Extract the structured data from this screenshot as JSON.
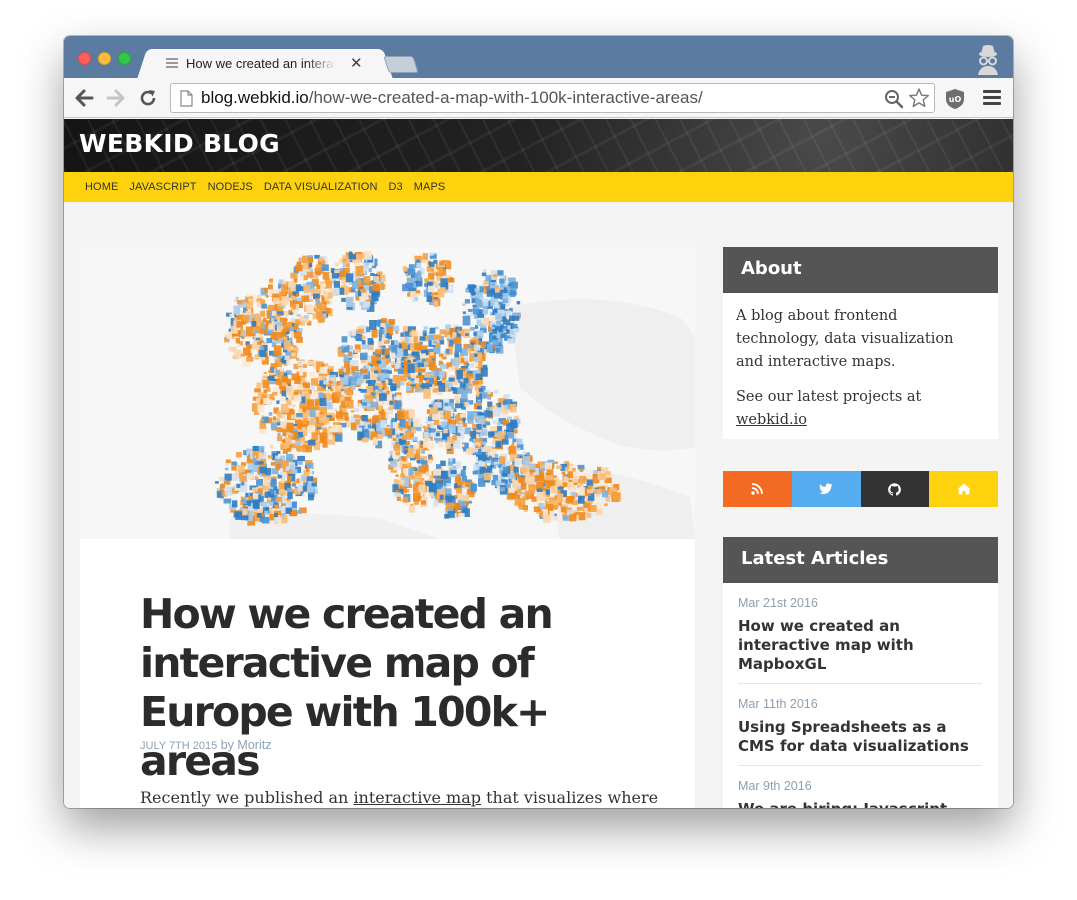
{
  "browser": {
    "tab_title": "How we created an interactive map",
    "tab_close": "✕",
    "url_host": "blog.webkid.io",
    "url_path": "/how-we-created-a-map-with-100k-interactive-areas/",
    "traffic_colors": {
      "close": "#fc605c",
      "minimize": "#fdbc40",
      "zoom": "#34c84a"
    },
    "icons": [
      "back-arrow-icon",
      "forward-arrow-icon",
      "reload-icon",
      "page-icon",
      "zoom-icon",
      "star-icon",
      "ublock-icon",
      "menu-icon",
      "incognito-icon"
    ]
  },
  "blog": {
    "title": "WEBKID BLOG",
    "accent_color": "#ffd20e",
    "categories": [
      "HOME",
      "JAVASCRIPT",
      "NODEJS",
      "DATA VISUALIZATION",
      "D3",
      "MAPS"
    ]
  },
  "article": {
    "title": "How we created an interactive map of Europe with 100k+ areas",
    "date": "July 7th 2015",
    "by": "by",
    "author": "Moritz",
    "body_start": "Recently we published an ",
    "body_link": "interactive map",
    "body_end": " that visualizes where"
  },
  "sidebar": {
    "about": {
      "heading": "About",
      "text": "A blog about frontend technology, data visualization and interactive maps.",
      "projects_prefix": "See our latest projects at ",
      "projects_link": "webkid.io"
    },
    "social": [
      {
        "name": "rss",
        "color": "#f36b22"
      },
      {
        "name": "twitter",
        "color": "#55acee"
      },
      {
        "name": "github",
        "color": "#333333"
      },
      {
        "name": "home",
        "color": "#ffd20e"
      }
    ],
    "latest": {
      "heading": "Latest Articles",
      "items": [
        {
          "date": "Mar 21st 2016",
          "title": "How we created an interactive map with MapboxGL"
        },
        {
          "date": "Mar 11th 2016",
          "title": "Using Spreadsheets as a CMS for data visualizations"
        },
        {
          "date": "Mar 9th 2016",
          "title": "We are hiring: Javascript Developer in Berlin"
        }
      ]
    }
  }
}
